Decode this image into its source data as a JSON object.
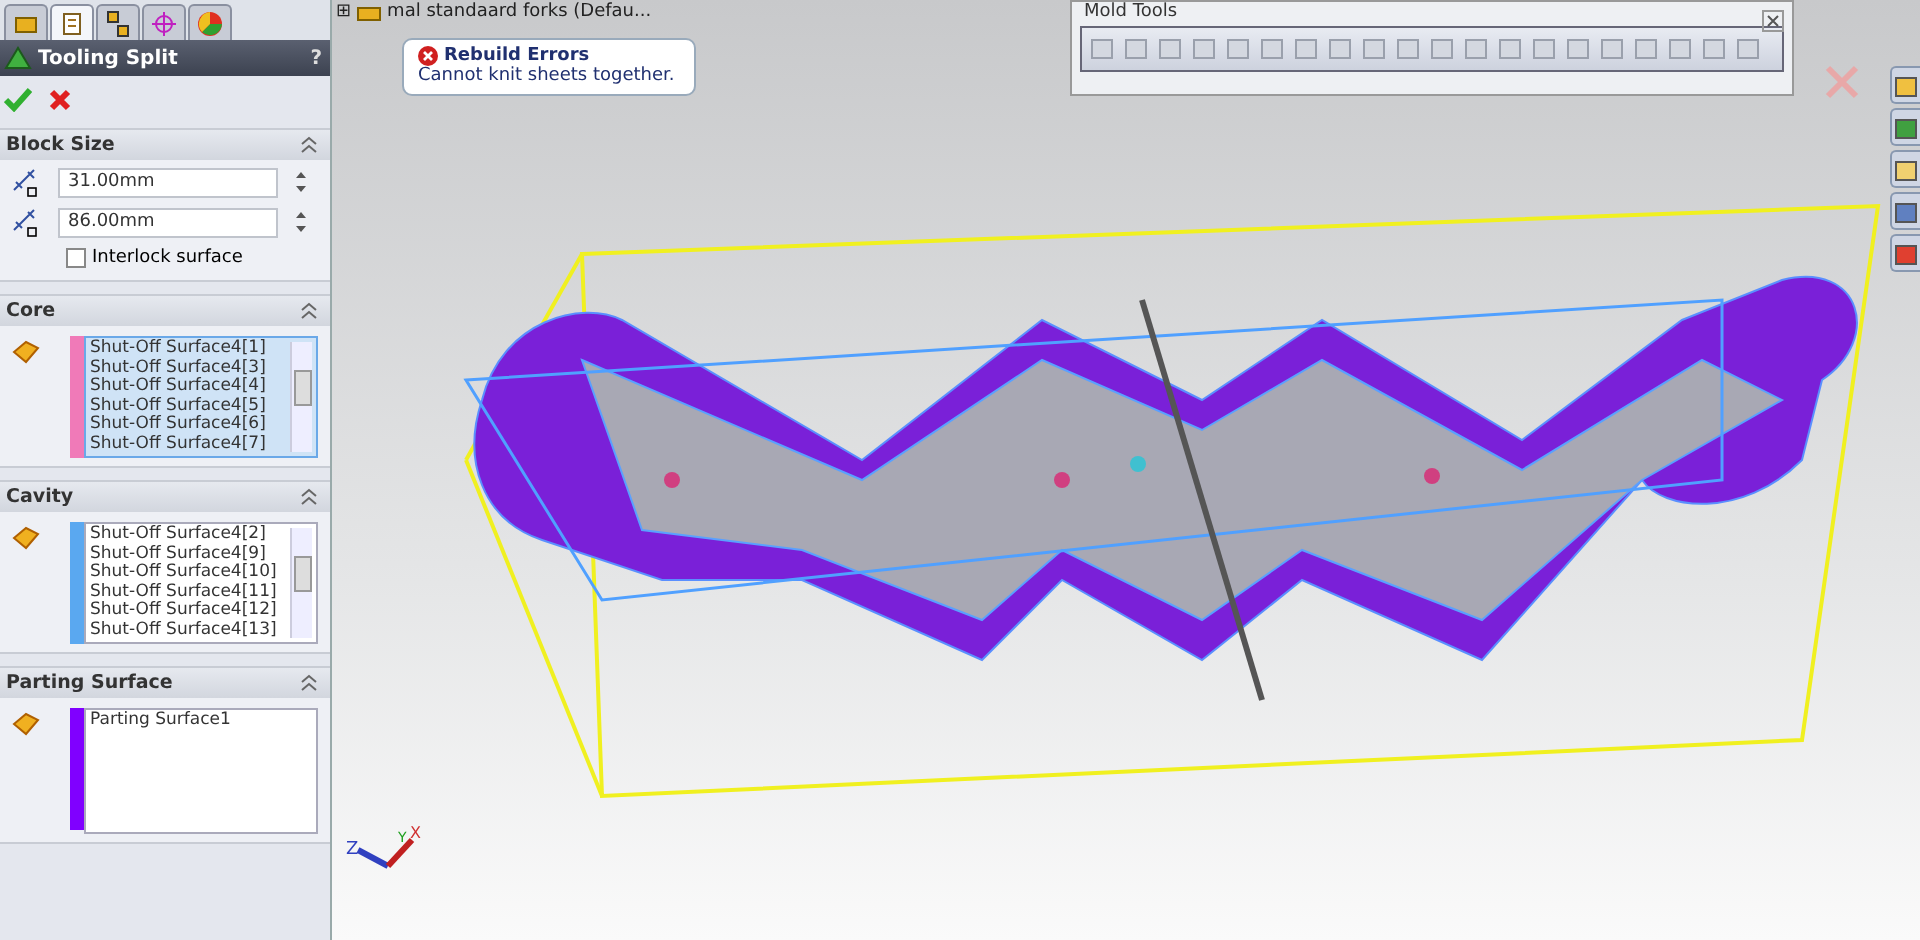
{
  "panel_tabs": [
    {
      "selected": false
    },
    {
      "selected": true
    },
    {
      "selected": false
    },
    {
      "selected": false
    },
    {
      "selected": false
    }
  ],
  "panel": {
    "title": "Tooling Split",
    "help": "?"
  },
  "sections": [
    {
      "kind": "block",
      "title": "Block Size",
      "fields": [
        {
          "value": "31.00mm"
        },
        {
          "value": "86.00mm"
        }
      ],
      "checkbox": {
        "label": "Interlock surface",
        "checked": false
      }
    },
    {
      "kind": "list",
      "title": "Core",
      "color": "#f07ab8",
      "active": true,
      "items": [
        "Shut-Off Surface4[1]",
        "Shut-Off Surface4[3]",
        "Shut-Off Surface4[4]",
        "Shut-Off Surface4[5]",
        "Shut-Off Surface4[6]",
        "Shut-Off Surface4[7]"
      ],
      "scrollbar": true
    },
    {
      "kind": "list",
      "title": "Cavity",
      "color": "#5aa8f0",
      "active": false,
      "items": [
        "Shut-Off Surface4[2]",
        "Shut-Off Surface4[9]",
        "Shut-Off Surface4[10]",
        "Shut-Off Surface4[11]",
        "Shut-Off Surface4[12]",
        "Shut-Off Surface4[13]"
      ],
      "scrollbar": true
    },
    {
      "kind": "list",
      "title": "Parting Surface",
      "color": "#8000ff",
      "active": false,
      "items": [
        "Parting Surface1"
      ],
      "scrollbar": false
    }
  ],
  "tree_item": {
    "expander": "⊞",
    "label": "mal standaard forks  (Defau..."
  },
  "tooltip": {
    "title": "Rebuild Errors",
    "message": "Cannot knit sheets together."
  },
  "toolbar": {
    "title": "Mold Tools"
  },
  "axes": {
    "z": "Z",
    "x": "X",
    "y": "Y"
  }
}
